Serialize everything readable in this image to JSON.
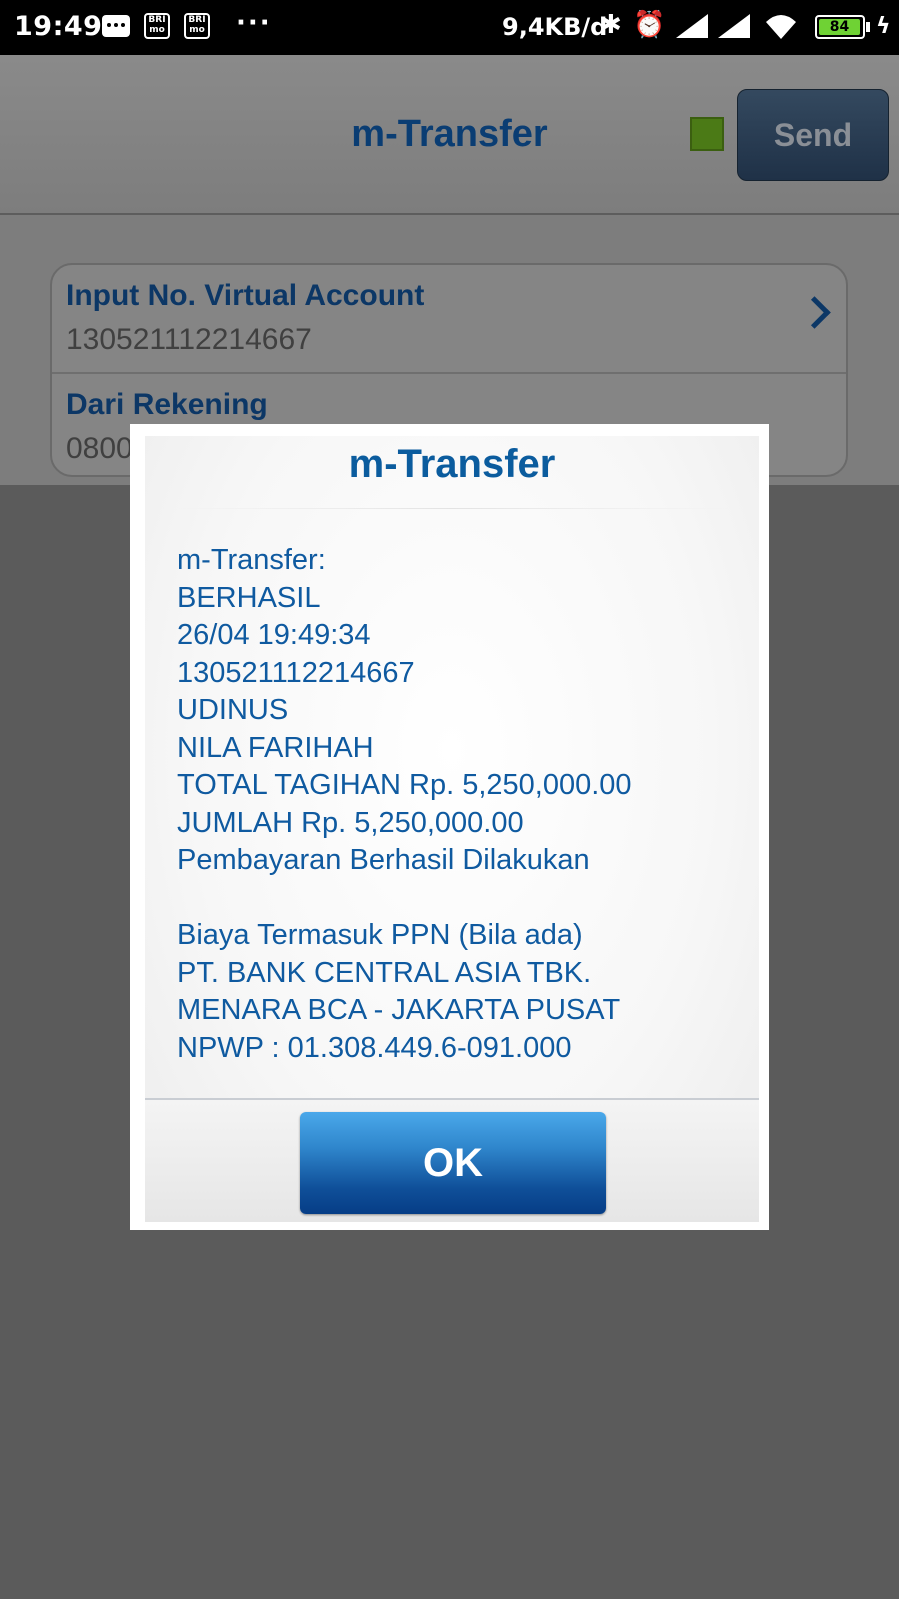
{
  "status_bar": {
    "time": "19:49",
    "notif_icon_1": "BRI mo",
    "notif_icon_2": "BRI mo",
    "more": "···",
    "net_speed": "9,4KB/d",
    "battery": "84",
    "icons": [
      "message-icon",
      "bri-mo-icon",
      "bri-mo-icon",
      "bluetooth-icon",
      "alarm-icon",
      "signal-icon",
      "signal-icon",
      "wifi-icon",
      "battery-icon",
      "charging-icon"
    ]
  },
  "header": {
    "title": "m-Transfer",
    "send_label": "Send",
    "status_color": "#4b7a16"
  },
  "form": {
    "rows": [
      {
        "label": "Input No. Virtual Account",
        "value": "130521112214667"
      },
      {
        "label": "Dari Rekening",
        "value": "0800"
      }
    ]
  },
  "dialog": {
    "title": "m-Transfer",
    "message": "m-Transfer:\nBERHASIL\n26/04 19:49:34\n130521112214667\nUDINUS\nNILA FARIHAH\nTOTAL TAGIHAN Rp. 5,250,000.00\nJUMLAH Rp. 5,250,000.00\nPembayaran Berhasil Dilakukan\n\nBiaya Termasuk PPN (Bila ada)\nPT. BANK CENTRAL ASIA TBK.\nMENARA BCA - JAKARTA PUSAT\nNPWP : 01.308.449.6-091.000",
    "ok_label": "OK"
  },
  "colors": {
    "accent": "#0b5c9e",
    "ok_button": "#0f4f99"
  }
}
